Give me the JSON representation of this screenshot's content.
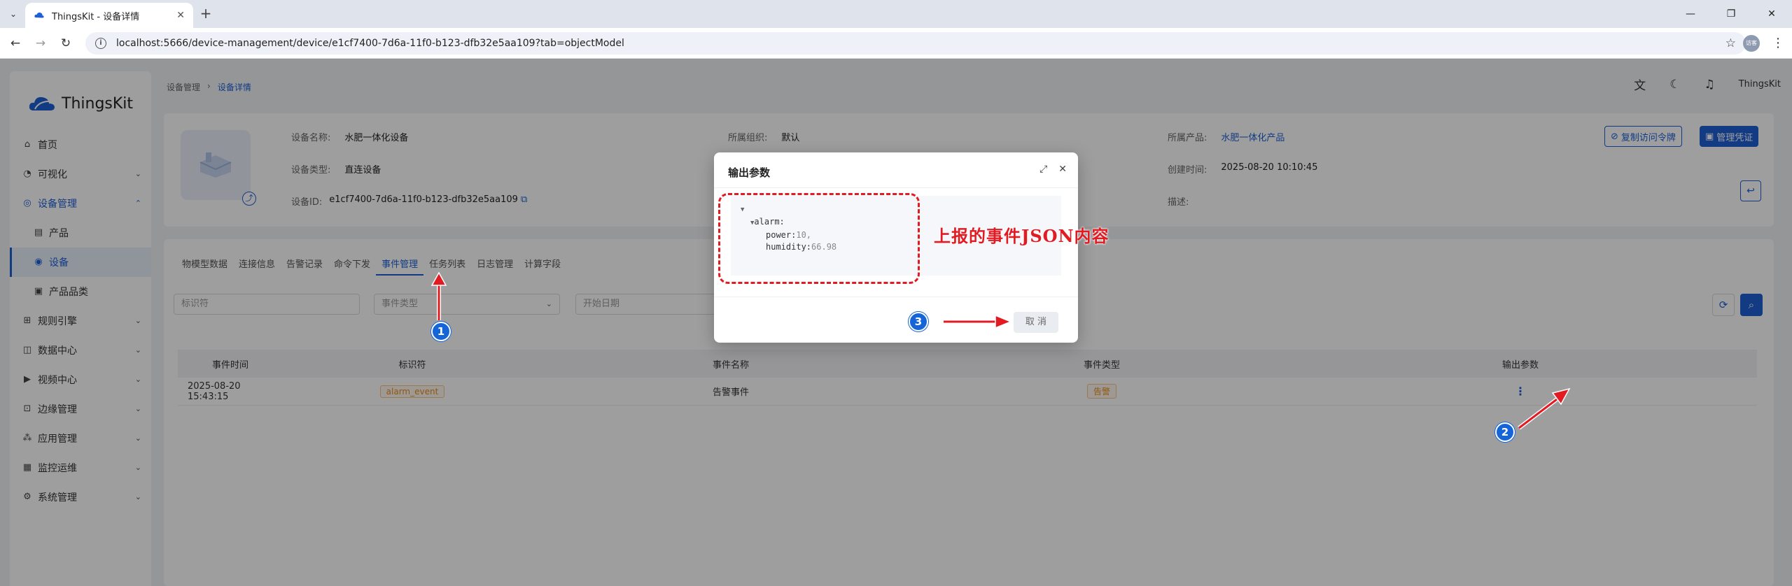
{
  "browser": {
    "tab_title": "ThingsKit - 设备详情",
    "url": "localhost:5666/device-management/device/e1cf7400-7d6a-11f0-b123-dfb32e5aa109?tab=objectModel",
    "profile_label": "访客"
  },
  "app": {
    "logo_text": "ThingsKit",
    "breadcrumb": [
      "设备管理",
      "设备详情"
    ],
    "header_user": "ThingsKit",
    "menu": [
      {
        "label": "首页",
        "icon": "home-icon"
      },
      {
        "label": "可视化",
        "icon": "dashboard-icon"
      },
      {
        "label": "设备管理",
        "icon": "device-icon"
      },
      {
        "label": "产品",
        "icon": "product-icon"
      },
      {
        "label": "设备",
        "icon": "eye-icon"
      },
      {
        "label": "产品品类",
        "icon": "category-icon"
      },
      {
        "label": "规则引擎",
        "icon": "rule-icon"
      },
      {
        "label": "数据中心",
        "icon": "data-icon"
      },
      {
        "label": "视频中心",
        "icon": "video-icon"
      },
      {
        "label": "边缘管理",
        "icon": "edge-icon"
      },
      {
        "label": "应用管理",
        "icon": "app-icon"
      },
      {
        "label": "监控运维",
        "icon": "monitor-icon"
      },
      {
        "label": "系统管理",
        "icon": "settings-icon"
      }
    ]
  },
  "device": {
    "name_label": "设备名称:",
    "name_value": "水肥一体化设备",
    "type_label": "设备类型:",
    "type_value": "直连设备",
    "id_label": "设备ID:",
    "id_value": "e1cf7400-7d6a-11f0-b123-dfb32e5aa109",
    "org_label": "所属组织:",
    "org_value": "默认",
    "product_label": "所属产品:",
    "product_value": "水肥一体化产品",
    "created_label": "创建时间:",
    "created_value": "2025-08-20 10:10:45",
    "desc_label": "描述:",
    "copy_token_btn": "复制访问令牌",
    "manage_cred_btn": "管理凭证"
  },
  "tabs": [
    "物模型数据",
    "连接信息",
    "告警记录",
    "命令下发",
    "事件管理",
    "任务列表",
    "日志管理",
    "计算字段"
  ],
  "filters": {
    "identifier_placeholder": "标识符",
    "event_type_placeholder": "事件类型",
    "start_date_placeholder": "开始日期"
  },
  "table": {
    "headers": [
      "事件时间",
      "标识符",
      "事件名称",
      "事件类型",
      "输出参数"
    ],
    "rows": [
      {
        "time": "2025-08-20 15:43:15",
        "identifier": "alarm_event",
        "name": "告警事件",
        "type": "告警"
      }
    ]
  },
  "modal": {
    "title": "输出参数",
    "json_lines": {
      "root_key": "alarm:",
      "power_key": "power:",
      "power_val": "10,",
      "humidity_key": "humidity:",
      "humidity_val": "66.98"
    },
    "cancel_label": "取 消"
  },
  "annotations": {
    "callout_text": "上报的事件JSON内容",
    "badge1": "1",
    "badge2": "2",
    "badge3": "3",
    "color": "#e21b23"
  }
}
